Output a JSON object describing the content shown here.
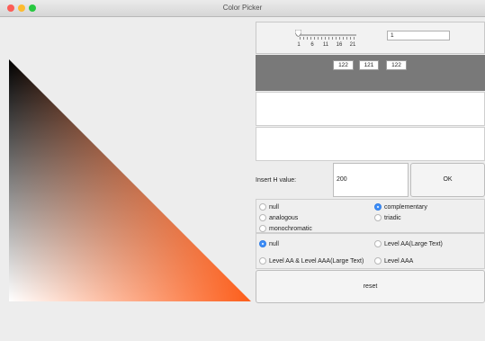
{
  "window": {
    "title": "Color Picker"
  },
  "slider": {
    "tick_labels": [
      "1",
      "6",
      "11",
      "16",
      "21"
    ],
    "value_field": "1"
  },
  "rgb": {
    "r": "122",
    "g": "121",
    "b": "122"
  },
  "h_input": {
    "label": "Insert H value:",
    "value": "200",
    "ok_label": "OK"
  },
  "harmony": {
    "options": [
      "null",
      "complementary",
      "analogous",
      "triadic",
      "monochromatic"
    ],
    "selected": "complementary"
  },
  "contrast": {
    "options": [
      "null",
      "Level AA(Large Text)",
      "Level AA & Level AAA(Large Text)",
      "Level AAA"
    ],
    "selected": "null"
  },
  "reset_label": "reset",
  "colors": {
    "accent": "#fc5d1a",
    "panel_gray": "#797979",
    "radio_selected": "#3f8ef7"
  }
}
